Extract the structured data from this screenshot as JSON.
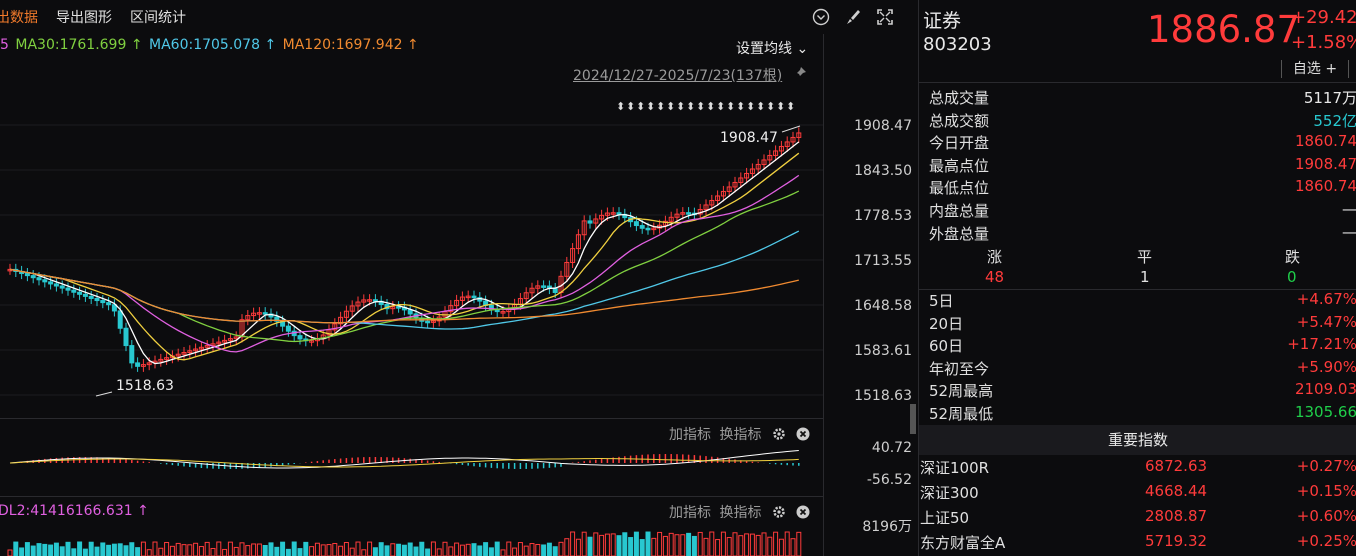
{
  "toolbar": {
    "tab_data": "出数据",
    "tab_export": "导出图形",
    "tab_stats": "区间统计"
  },
  "ma": {
    "prefix": "5",
    "ma30": "MA30:1761.699 ↑",
    "ma60": "MA60:1705.078 ↑",
    "ma120": "MA120:1697.942 ↑",
    "settings": "设置均线",
    "range": "2024/12/27-2025/7/23(137根)"
  },
  "main_axis": [
    "1908.47",
    "1843.50",
    "1778.53",
    "1713.55",
    "1648.58",
    "1583.61",
    "1518.63"
  ],
  "annotations": {
    "high": "1908.47",
    "low": "1518.63"
  },
  "sub1": {
    "add": "加指标",
    "switch": "换指标",
    "axis_top": "40.72",
    "axis_bottom": "-56.52"
  },
  "sub2": {
    "prefix": "DL2:41416166.631 ↑",
    "add": "加指标",
    "switch": "换指标",
    "axis_top": "8196万"
  },
  "colors": {
    "up": "#ff3b3b",
    "down": "#28c8d0",
    "ma5": "#ffffff",
    "ma10": "#f0d040",
    "ma20": "#e060e0",
    "ma30": "#80d040",
    "ma60": "#50c8e8",
    "ma120": "#f08a30"
  },
  "chart_data": {
    "type": "candlestick",
    "ylim": [
      1518.63,
      1908.47
    ],
    "high": 1908.47,
    "low": 1518.63,
    "ma": [
      {
        "name": "MA30",
        "value": 1761.699
      },
      {
        "name": "MA60",
        "value": 1705.078
      },
      {
        "name": "MA120",
        "value": 1697.942
      }
    ]
  },
  "quote": {
    "name": "证券",
    "code": "803203",
    "price": "1886.87",
    "change": "+29.42",
    "change_pct": "+1.58%",
    "fav": "自选 +"
  },
  "stats": [
    {
      "label": "总成交量",
      "value": "5117万",
      "color": "white"
    },
    {
      "label": "总成交额",
      "value": "552亿",
      "color": "cyan"
    },
    {
      "label": "今日开盘",
      "value": "1860.74",
      "color": "red"
    },
    {
      "label": "最高点位",
      "value": "1908.47",
      "color": "red"
    },
    {
      "label": "最低点位",
      "value": "1860.74",
      "color": "red"
    },
    {
      "label": "内盘总量",
      "value": "—",
      "color": "white"
    },
    {
      "label": "外盘总量",
      "value": "—",
      "color": "white"
    }
  ],
  "breadth": {
    "up_label": "涨",
    "flat_label": "平",
    "down_label": "跌",
    "up": "48",
    "flat": "1",
    "down": "0"
  },
  "perf": [
    {
      "label": "5日",
      "value": "+4.67%",
      "color": "red"
    },
    {
      "label": "20日",
      "value": "+5.47%",
      "color": "red"
    },
    {
      "label": "60日",
      "value": "+17.21%",
      "color": "red"
    },
    {
      "label": "年初至今",
      "value": "+5.90%",
      "color": "red"
    },
    {
      "label": "52周最高",
      "value": "2109.03",
      "color": "red"
    },
    {
      "label": "52周最低",
      "value": "1305.66",
      "color": "green"
    }
  ],
  "indices": {
    "title": "重要指数",
    "rows": [
      {
        "name": "深证100R",
        "price": "6872.63",
        "chg": "+0.27%"
      },
      {
        "name": "深证300",
        "price": "4668.44",
        "chg": "+0.15%"
      },
      {
        "name": "上证50",
        "price": "2808.87",
        "chg": "+0.60%"
      },
      {
        "name": "东方财富全A",
        "price": "5719.32",
        "chg": "+0.25%"
      }
    ]
  }
}
